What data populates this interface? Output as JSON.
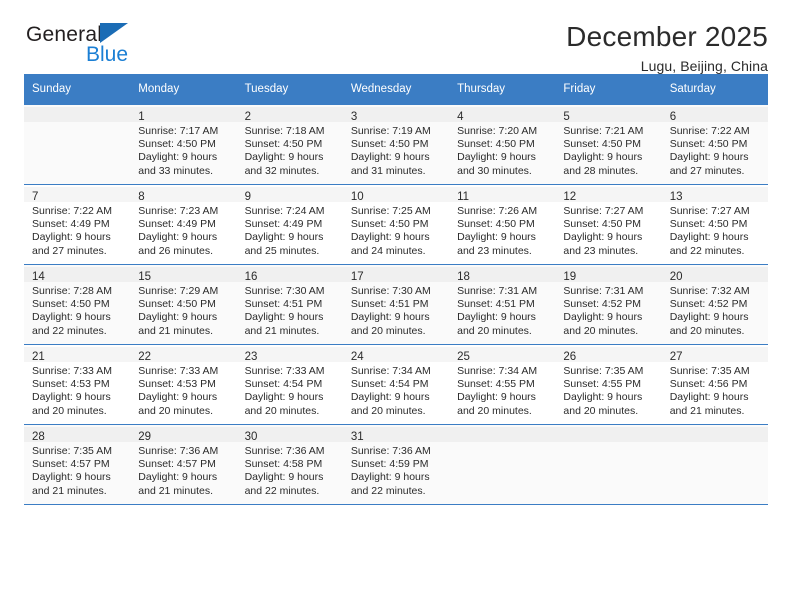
{
  "brand": {
    "name_part1": "General",
    "name_part2": "Blue",
    "triangle_icon": "triangle-icon",
    "accent_color": "#1b7fd4"
  },
  "header": {
    "title": "December 2025",
    "subtitle": "Lugu, Beijing, China"
  },
  "calendar": {
    "header_bg": "#3b7dc4",
    "header_text_color": "#ffffff",
    "weekday_headers": [
      "Sunday",
      "Monday",
      "Tuesday",
      "Wednesday",
      "Thursday",
      "Friday",
      "Saturday"
    ],
    "weeks": [
      [
        {
          "day": "",
          "sunrise": "",
          "sunset": "",
          "daylight1": "",
          "daylight2": ""
        },
        {
          "day": "1",
          "sunrise": "Sunrise: 7:17 AM",
          "sunset": "Sunset: 4:50 PM",
          "daylight1": "Daylight: 9 hours",
          "daylight2": "and 33 minutes."
        },
        {
          "day": "2",
          "sunrise": "Sunrise: 7:18 AM",
          "sunset": "Sunset: 4:50 PM",
          "daylight1": "Daylight: 9 hours",
          "daylight2": "and 32 minutes."
        },
        {
          "day": "3",
          "sunrise": "Sunrise: 7:19 AM",
          "sunset": "Sunset: 4:50 PM",
          "daylight1": "Daylight: 9 hours",
          "daylight2": "and 31 minutes."
        },
        {
          "day": "4",
          "sunrise": "Sunrise: 7:20 AM",
          "sunset": "Sunset: 4:50 PM",
          "daylight1": "Daylight: 9 hours",
          "daylight2": "and 30 minutes."
        },
        {
          "day": "5",
          "sunrise": "Sunrise: 7:21 AM",
          "sunset": "Sunset: 4:50 PM",
          "daylight1": "Daylight: 9 hours",
          "daylight2": "and 28 minutes."
        },
        {
          "day": "6",
          "sunrise": "Sunrise: 7:22 AM",
          "sunset": "Sunset: 4:50 PM",
          "daylight1": "Daylight: 9 hours",
          "daylight2": "and 27 minutes."
        }
      ],
      [
        {
          "day": "7",
          "sunrise": "Sunrise: 7:22 AM",
          "sunset": "Sunset: 4:49 PM",
          "daylight1": "Daylight: 9 hours",
          "daylight2": "and 27 minutes."
        },
        {
          "day": "8",
          "sunrise": "Sunrise: 7:23 AM",
          "sunset": "Sunset: 4:49 PM",
          "daylight1": "Daylight: 9 hours",
          "daylight2": "and 26 minutes."
        },
        {
          "day": "9",
          "sunrise": "Sunrise: 7:24 AM",
          "sunset": "Sunset: 4:49 PM",
          "daylight1": "Daylight: 9 hours",
          "daylight2": "and 25 minutes."
        },
        {
          "day": "10",
          "sunrise": "Sunrise: 7:25 AM",
          "sunset": "Sunset: 4:50 PM",
          "daylight1": "Daylight: 9 hours",
          "daylight2": "and 24 minutes."
        },
        {
          "day": "11",
          "sunrise": "Sunrise: 7:26 AM",
          "sunset": "Sunset: 4:50 PM",
          "daylight1": "Daylight: 9 hours",
          "daylight2": "and 23 minutes."
        },
        {
          "day": "12",
          "sunrise": "Sunrise: 7:27 AM",
          "sunset": "Sunset: 4:50 PM",
          "daylight1": "Daylight: 9 hours",
          "daylight2": "and 23 minutes."
        },
        {
          "day": "13",
          "sunrise": "Sunrise: 7:27 AM",
          "sunset": "Sunset: 4:50 PM",
          "daylight1": "Daylight: 9 hours",
          "daylight2": "and 22 minutes."
        }
      ],
      [
        {
          "day": "14",
          "sunrise": "Sunrise: 7:28 AM",
          "sunset": "Sunset: 4:50 PM",
          "daylight1": "Daylight: 9 hours",
          "daylight2": "and 22 minutes."
        },
        {
          "day": "15",
          "sunrise": "Sunrise: 7:29 AM",
          "sunset": "Sunset: 4:50 PM",
          "daylight1": "Daylight: 9 hours",
          "daylight2": "and 21 minutes."
        },
        {
          "day": "16",
          "sunrise": "Sunrise: 7:30 AM",
          "sunset": "Sunset: 4:51 PM",
          "daylight1": "Daylight: 9 hours",
          "daylight2": "and 21 minutes."
        },
        {
          "day": "17",
          "sunrise": "Sunrise: 7:30 AM",
          "sunset": "Sunset: 4:51 PM",
          "daylight1": "Daylight: 9 hours",
          "daylight2": "and 20 minutes."
        },
        {
          "day": "18",
          "sunrise": "Sunrise: 7:31 AM",
          "sunset": "Sunset: 4:51 PM",
          "daylight1": "Daylight: 9 hours",
          "daylight2": "and 20 minutes."
        },
        {
          "day": "19",
          "sunrise": "Sunrise: 7:31 AM",
          "sunset": "Sunset: 4:52 PM",
          "daylight1": "Daylight: 9 hours",
          "daylight2": "and 20 minutes."
        },
        {
          "day": "20",
          "sunrise": "Sunrise: 7:32 AM",
          "sunset": "Sunset: 4:52 PM",
          "daylight1": "Daylight: 9 hours",
          "daylight2": "and 20 minutes."
        }
      ],
      [
        {
          "day": "21",
          "sunrise": "Sunrise: 7:33 AM",
          "sunset": "Sunset: 4:53 PM",
          "daylight1": "Daylight: 9 hours",
          "daylight2": "and 20 minutes."
        },
        {
          "day": "22",
          "sunrise": "Sunrise: 7:33 AM",
          "sunset": "Sunset: 4:53 PM",
          "daylight1": "Daylight: 9 hours",
          "daylight2": "and 20 minutes."
        },
        {
          "day": "23",
          "sunrise": "Sunrise: 7:33 AM",
          "sunset": "Sunset: 4:54 PM",
          "daylight1": "Daylight: 9 hours",
          "daylight2": "and 20 minutes."
        },
        {
          "day": "24",
          "sunrise": "Sunrise: 7:34 AM",
          "sunset": "Sunset: 4:54 PM",
          "daylight1": "Daylight: 9 hours",
          "daylight2": "and 20 minutes."
        },
        {
          "day": "25",
          "sunrise": "Sunrise: 7:34 AM",
          "sunset": "Sunset: 4:55 PM",
          "daylight1": "Daylight: 9 hours",
          "daylight2": "and 20 minutes."
        },
        {
          "day": "26",
          "sunrise": "Sunrise: 7:35 AM",
          "sunset": "Sunset: 4:55 PM",
          "daylight1": "Daylight: 9 hours",
          "daylight2": "and 20 minutes."
        },
        {
          "day": "27",
          "sunrise": "Sunrise: 7:35 AM",
          "sunset": "Sunset: 4:56 PM",
          "daylight1": "Daylight: 9 hours",
          "daylight2": "and 21 minutes."
        }
      ],
      [
        {
          "day": "28",
          "sunrise": "Sunrise: 7:35 AM",
          "sunset": "Sunset: 4:57 PM",
          "daylight1": "Daylight: 9 hours",
          "daylight2": "and 21 minutes."
        },
        {
          "day": "29",
          "sunrise": "Sunrise: 7:36 AM",
          "sunset": "Sunset: 4:57 PM",
          "daylight1": "Daylight: 9 hours",
          "daylight2": "and 21 minutes."
        },
        {
          "day": "30",
          "sunrise": "Sunrise: 7:36 AM",
          "sunset": "Sunset: 4:58 PM",
          "daylight1": "Daylight: 9 hours",
          "daylight2": "and 22 minutes."
        },
        {
          "day": "31",
          "sunrise": "Sunrise: 7:36 AM",
          "sunset": "Sunset: 4:59 PM",
          "daylight1": "Daylight: 9 hours",
          "daylight2": "and 22 minutes."
        },
        {
          "day": "",
          "sunrise": "",
          "sunset": "",
          "daylight1": "",
          "daylight2": ""
        },
        {
          "day": "",
          "sunrise": "",
          "sunset": "",
          "daylight1": "",
          "daylight2": ""
        },
        {
          "day": "",
          "sunrise": "",
          "sunset": "",
          "daylight1": "",
          "daylight2": ""
        }
      ]
    ]
  }
}
